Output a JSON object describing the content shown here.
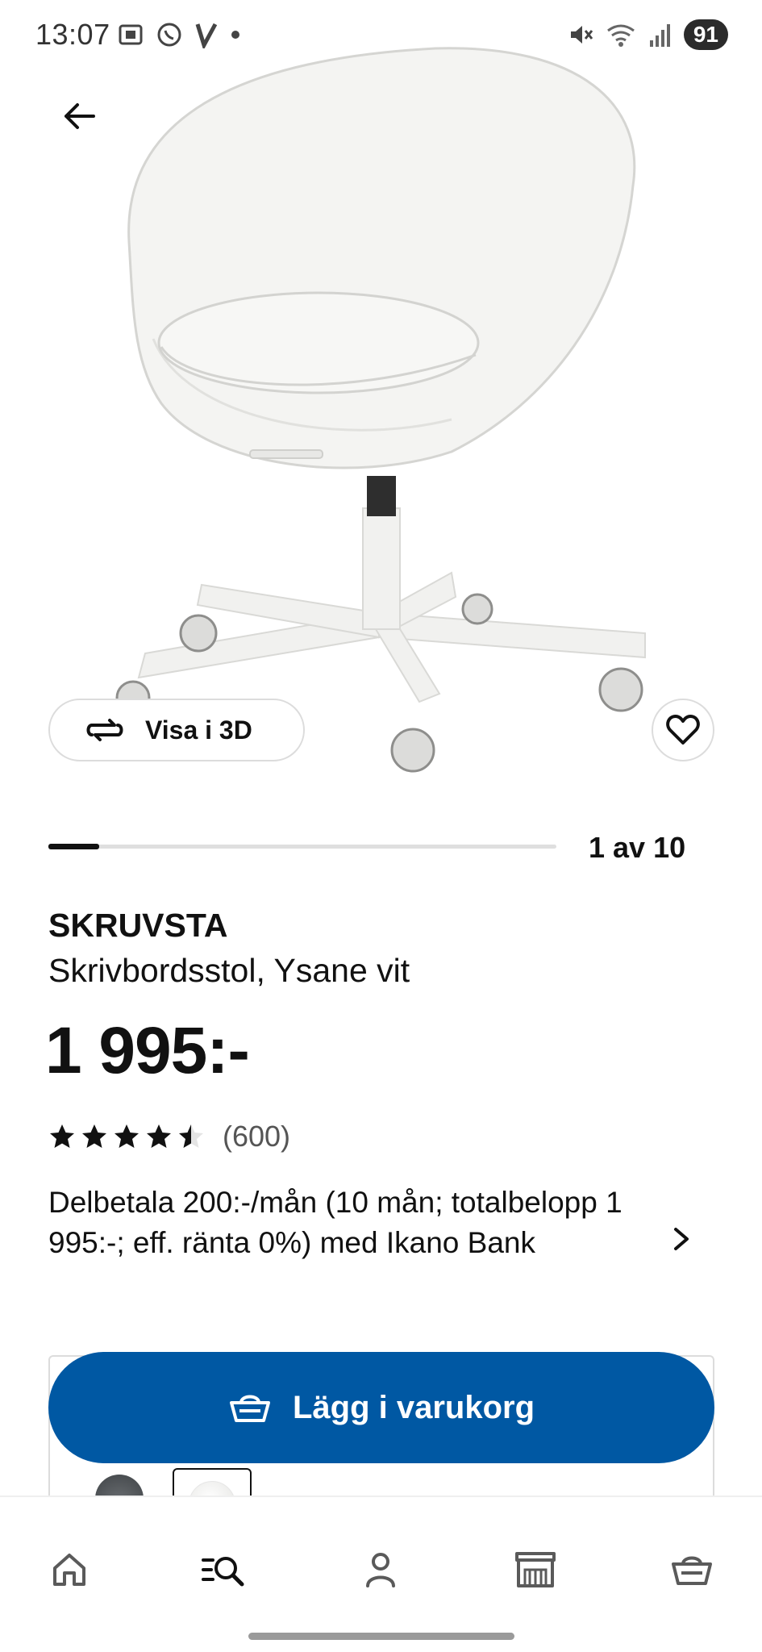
{
  "status_bar": {
    "time": "13:07",
    "battery": "91"
  },
  "product": {
    "visa_3d_label": "Visa i 3D",
    "image_counter": "1 av 10",
    "image_progress_fraction": 0.1,
    "name": "SKRUVSTA",
    "description": "Skrivbordsstol, Ysane vit",
    "price": "1 995:-",
    "rating_value": 4.5,
    "rating_count": "(600)",
    "installment_text": "Delbetala 200:-/mån (10 mån; totalbelopp 1 995:-; eff. ränta 0%) med Ikano Bank"
  },
  "cart": {
    "add_to_cart_label": "Lägg i varukorg"
  },
  "colors": {
    "primary_blue": "#0058a3",
    "star": "#111111",
    "chair_white": "#f4f4f2"
  },
  "icons": {
    "back": "arrow-left-icon",
    "visa_3d": "rotate-3d-icon",
    "favorite": "heart-icon",
    "chevron": "chevron-right-icon",
    "cart": "basket-icon",
    "nav": [
      "home-icon",
      "search-list-icon",
      "user-icon",
      "store-icon",
      "basket-icon"
    ]
  }
}
